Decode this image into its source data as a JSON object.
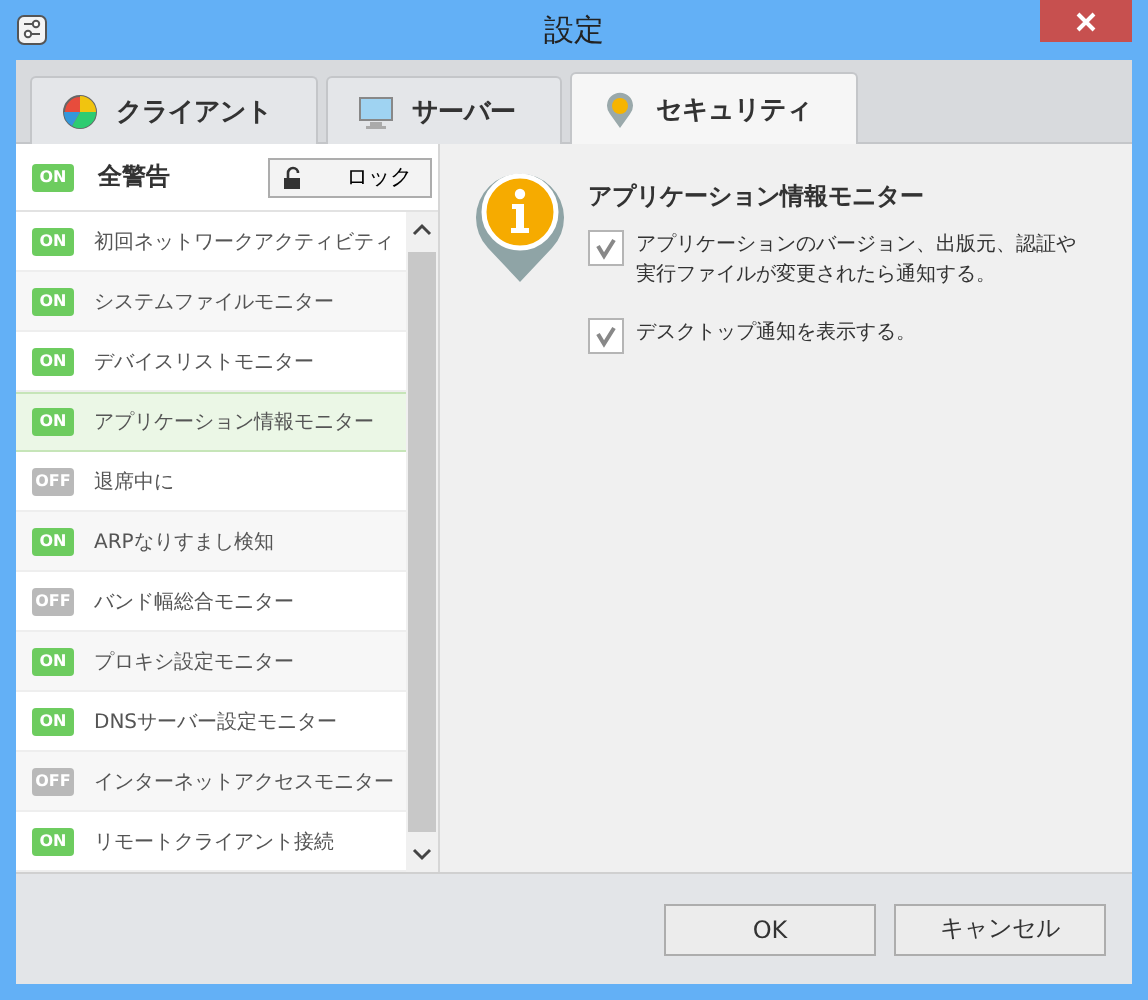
{
  "window": {
    "title": "設定"
  },
  "tabs": [
    {
      "label": "クライアント",
      "selected": false,
      "kind": "client"
    },
    {
      "label": "サーバー",
      "selected": false,
      "kind": "server"
    },
    {
      "label": "セキュリティ",
      "selected": true,
      "kind": "security"
    }
  ],
  "all_alerts": {
    "switch": "ON",
    "on": true,
    "label": "全警告",
    "lock_button": "ロック"
  },
  "monitors": [
    {
      "switch": "ON",
      "on": true,
      "label": "初回ネットワークアクティビティ",
      "selected": false
    },
    {
      "switch": "ON",
      "on": true,
      "label": "システムファイルモニター",
      "selected": false
    },
    {
      "switch": "ON",
      "on": true,
      "label": "デバイスリストモニター",
      "selected": false
    },
    {
      "switch": "ON",
      "on": true,
      "label": "アプリケーション情報モニター",
      "selected": true
    },
    {
      "switch": "OFF",
      "on": false,
      "label": "退席中に",
      "selected": false
    },
    {
      "switch": "ON",
      "on": true,
      "label": "ARPなりすまし検知",
      "selected": false
    },
    {
      "switch": "OFF",
      "on": false,
      "label": "バンド幅総合モニター",
      "selected": false
    },
    {
      "switch": "ON",
      "on": true,
      "label": "プロキシ設定モニター",
      "selected": false
    },
    {
      "switch": "ON",
      "on": true,
      "label": "DNSサーバー設定モニター",
      "selected": false
    },
    {
      "switch": "OFF",
      "on": false,
      "label": "インターネットアクセスモニター",
      "selected": false
    },
    {
      "switch": "ON",
      "on": true,
      "label": "リモートクライアント接続",
      "selected": false
    }
  ],
  "detail": {
    "title": "アプリケーション情報モニター",
    "options": [
      {
        "label": "アプリケーションのバージョン、出版元、認証や実行ファイルが変更されたら通知する。",
        "checked": true
      },
      {
        "label": "デスクトップ通知を表示する。",
        "checked": true
      }
    ]
  },
  "buttons": [
    "OK",
    "キャンセル"
  ]
}
